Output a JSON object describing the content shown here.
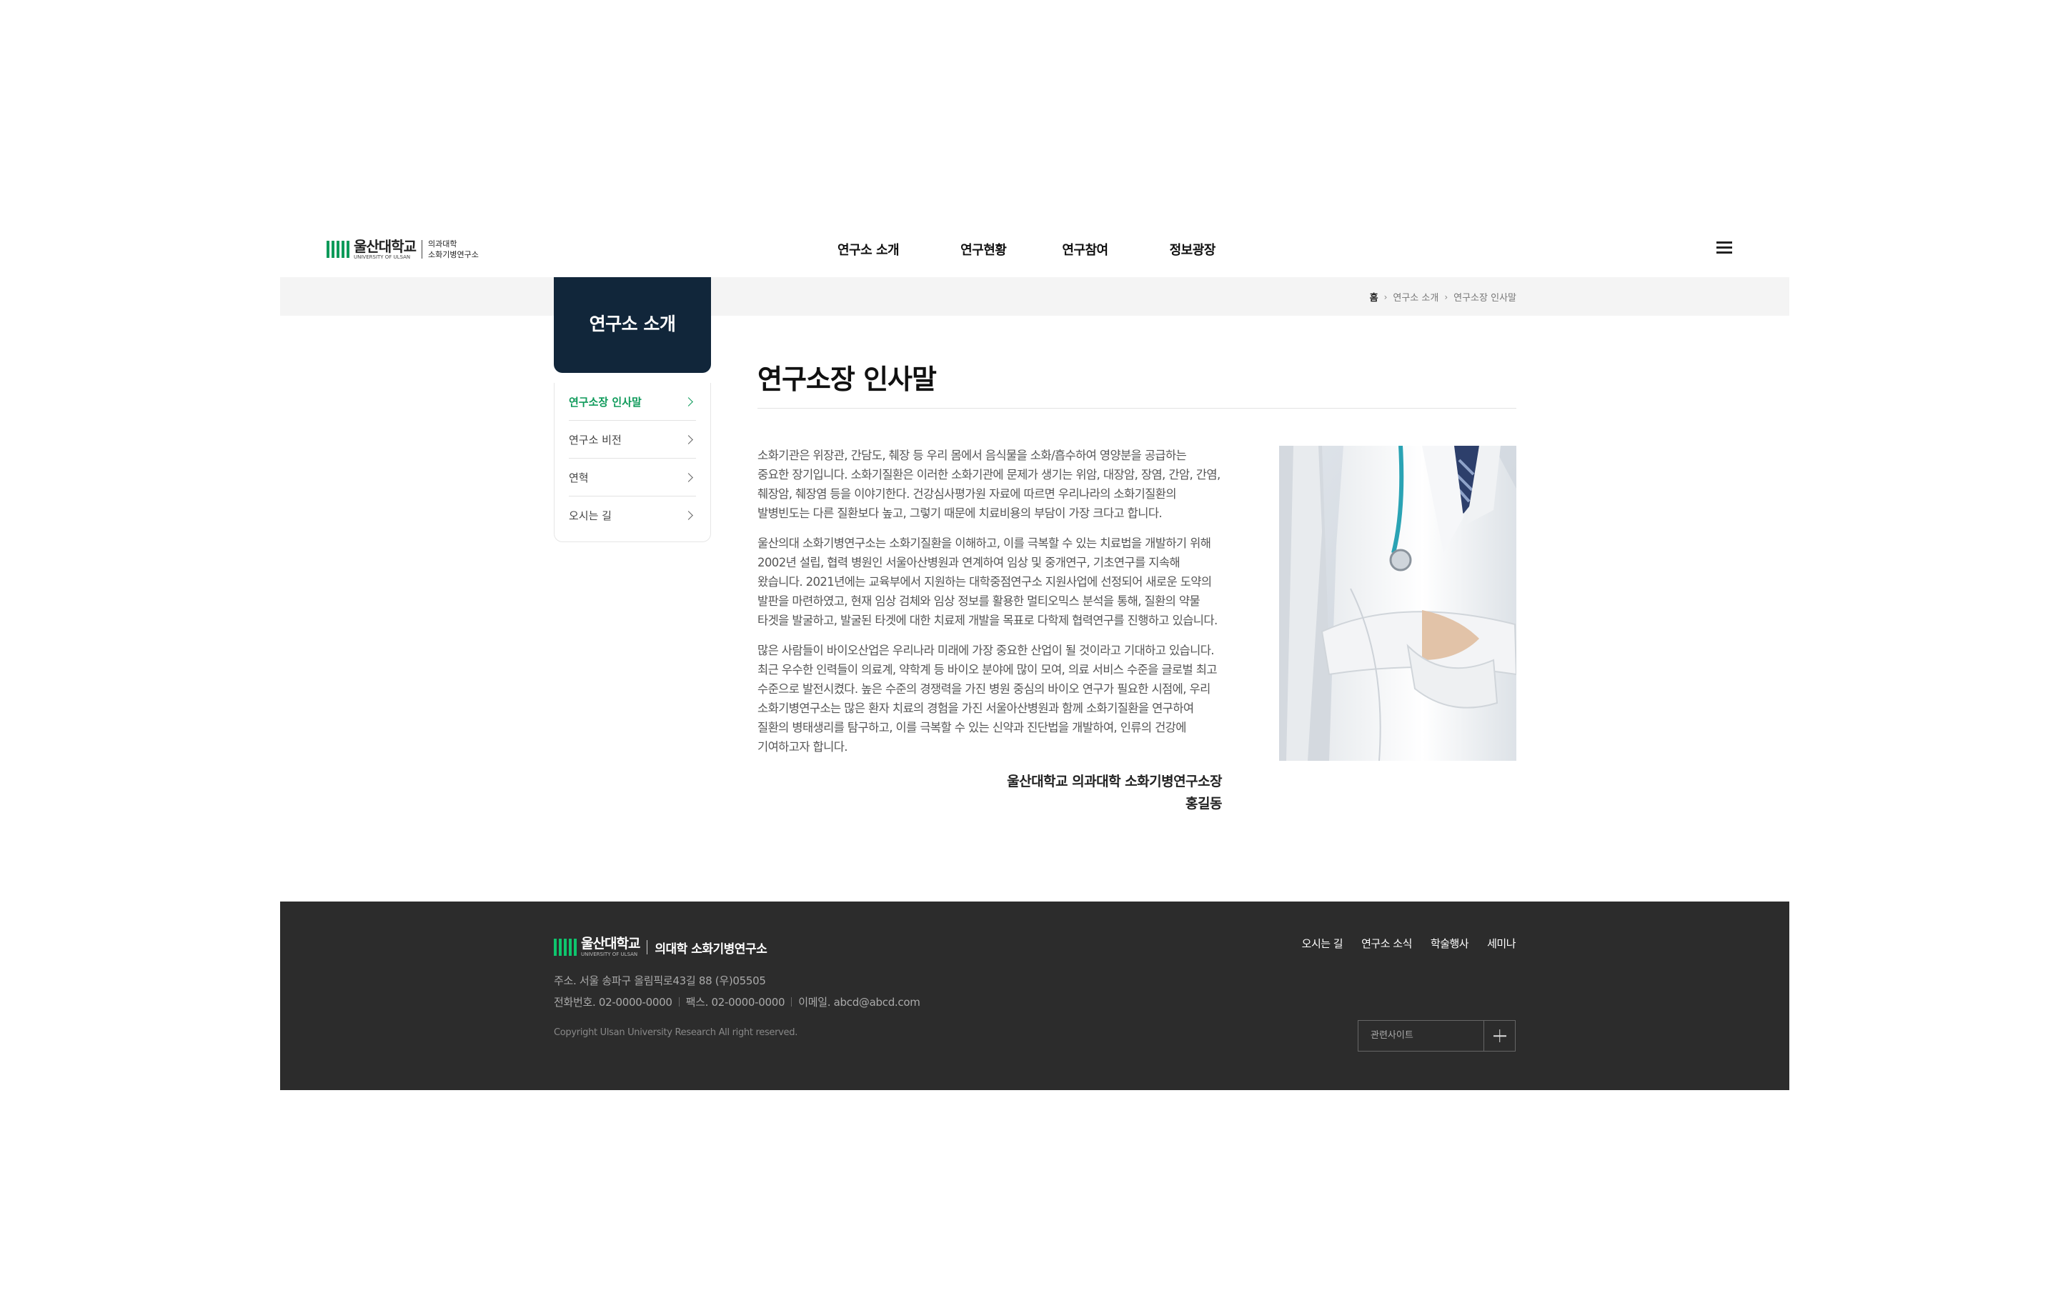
{
  "header": {
    "logo_main": "울산대학교",
    "logo_sub": "UNIVERSITY OF ULSAN",
    "logo_right_line1": "의과대학",
    "logo_right_line2": "소화기병연구소",
    "nav": [
      "연구소 소개",
      "연구현황",
      "연구참여",
      "정보광장"
    ],
    "menu_icon": "hamburger-icon"
  },
  "breadcrumb": {
    "home": "홈",
    "level1": "연구소 소개",
    "level2": "연구소장 인사말"
  },
  "sidebar": {
    "title": "연구소 소개",
    "items": [
      {
        "label": "연구소장 인사말",
        "active": true
      },
      {
        "label": "연구소 비전",
        "active": false
      },
      {
        "label": "연혁",
        "active": false
      },
      {
        "label": "오시는 길",
        "active": false
      }
    ]
  },
  "main": {
    "title": "연구소장 인사말",
    "paragraphs": [
      "소화기관은 위장관, 간담도, 췌장 등 우리 몸에서 음식물을 소화/흡수하여 영양분을 공급하는\n중요한 장기입니다. 소화기질환은 이러한 소화기관에 문제가 생기는 위암, 대장암, 장염, 간암, 간염,\n췌장암, 췌장염 등을 이야기한다. 건강심사평가원 자료에 따르면 우리나라의 소화기질환의\n발병빈도는 다른 질환보다  높고, 그렇기 때문에 치료비용의 부담이 가장 크다고 합니다.",
      "울산의대 소화기병연구소는 소화기질환을 이해하고, 이를 극복할 수 있는 치료법을 개발하기 위해\n2002년 설립, 협력 병원인 서울아산병원과 연계하여 임상 및 중개연구, 기초연구를 지속해\n왔습니다. 2021년에는 교육부에서 지원하는 대학중점연구소 지원사업에 선정되어 새로운 도약의\n발판을 마련하였고, 현재 임상 검체와  임상 정보를 활용한 멀티오믹스 분석을 통해, 질환의 약물\n타겟을 발굴하고, 발굴된 타겟에 대한 치료제 개발을 목표로 다학제 협력연구를 진행하고 있습니다.",
      "많은 사람들이 바이오산업은 우리나라 미래에 가장 중요한 산업이 될 것이라고 기대하고 있습니다.\n최근 우수한 인력들이 의료계, 약학계 등 바이오 분야에 많이 모여, 의료 서비스 수준을 글로벌 최고\n수준으로 발전시켰다. 높은 수준의 경쟁력을 가진 병원 중심의 바이오 연구가 필요한 시점에, 우리\n소화기병연구소는 많은 환자 치료의 경험을 가진 서울아산병원과 함께 소화기질환을 연구하여\n질환의 병태생리를 탐구하고, 이를 극복할 수 있는 신약과 진단법을 개발하여, 인류의 건강에\n기여하고자 합니다."
    ],
    "signature_line1": "울산대학교 의과대학 소화기병연구소장",
    "signature_line2": "홍길동"
  },
  "footer": {
    "logo_main": "울산대학교",
    "logo_sub": "UNIVERSITY OF ULSAN",
    "title": "의대학 소화기병연구소",
    "address": "주소. 서울 송파구 올림픽로43길 88 (우)05505",
    "phone": "전화번호. 02-0000-0000",
    "fax": "팩스. 02-0000-0000",
    "email": "이메일. abcd@abcd.com",
    "copyright": "Copyright Ulsan University Research All right reserved.",
    "links": [
      "오시는 길",
      "연구소 소식",
      "학술행사",
      "세미나"
    ],
    "related_sites_label": "관련사이트"
  },
  "colors": {
    "accent_green": "#0e9a5a",
    "sidebar_head": "#11263a",
    "footer_bg": "#2c2c2c",
    "band_bg": "#f4f4f4"
  }
}
